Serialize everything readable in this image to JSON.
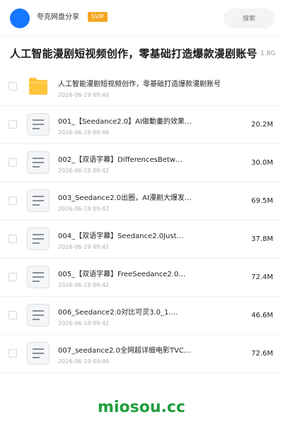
{
  "header": {
    "share_title": "夸克网盘分享",
    "badge": "SVIP",
    "search_placeholder": "搜索"
  },
  "page": {
    "title": "人工智能漫剧短视频创作，零基础打造爆款漫剧账号",
    "total_size": "1.8G"
  },
  "folder": {
    "name": "人工智能漫剧短视频创作，零基础打造爆款漫剧账号",
    "date": "2026-06-19 09:46"
  },
  "files": [
    {
      "name": "001_【Seedance2.0】AI做動畫的效果…",
      "date": "2026-06-19 09:46",
      "size": "20.2M"
    },
    {
      "name": "002_【双语字幕】DifferencesBetw…",
      "date": "2026-06-19 09:42",
      "size": "30.0M"
    },
    {
      "name": "003_Seedance2.0出圈，AI漫剧大爆发…",
      "date": "2026-06-19 09:42",
      "size": "69.5M"
    },
    {
      "name": "004_【双语字幕】Seedance2.0Just…",
      "date": "2026-06-19 09:42",
      "size": "37.8M"
    },
    {
      "name": "005_【双语字幕】FreeSeedance2.0…",
      "date": "2026-06-19 09:42",
      "size": "72.4M"
    },
    {
      "name": "006_Seedance2.0对比可灵3.0_1.…",
      "date": "2026-06-19 09:42",
      "size": "46.6M"
    },
    {
      "name": "007_seedance2.0全网超详细电影TVC…",
      "date": "2026-06-19 09:46",
      "size": "72.6M"
    }
  ],
  "watermark": "miosou.cc",
  "colors": {
    "accent": "#1677ff",
    "badge": "#f5a623",
    "folder": "#ffc53d",
    "watermark": "#1e9e3c"
  },
  "icons": {
    "folder": "folder-icon",
    "file": "document-icon"
  }
}
